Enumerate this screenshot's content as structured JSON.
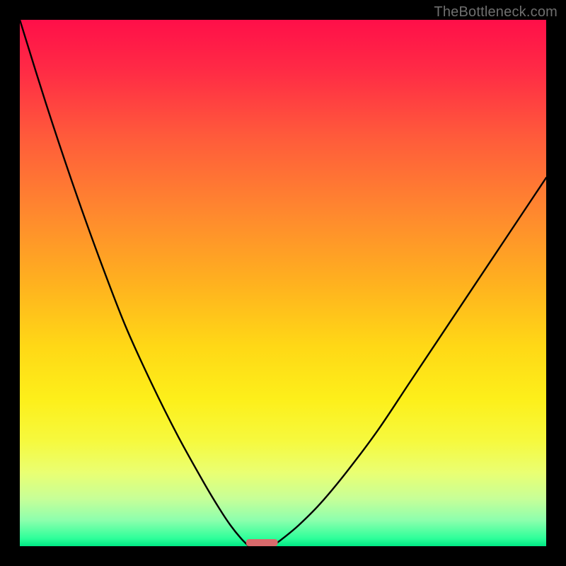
{
  "watermark": "TheBottleneck.com",
  "chart_data": {
    "type": "line",
    "title": "",
    "xlabel": "",
    "ylabel": "",
    "xlim": [
      0,
      100
    ],
    "ylim": [
      0,
      100
    ],
    "grid": false,
    "legend": false,
    "annotations": [],
    "series": [
      {
        "name": "left-branch",
        "x": [
          0,
          5,
          10,
          15,
          20,
          25,
          30,
          35,
          38,
          40,
          42,
          43.5
        ],
        "y": [
          100,
          84,
          69,
          55,
          42,
          31,
          21,
          12,
          7,
          4,
          1.5,
          0
        ]
      },
      {
        "name": "right-branch",
        "x": [
          48,
          50,
          53,
          57,
          62,
          68,
          74,
          80,
          86,
          92,
          98,
          100
        ],
        "y": [
          0,
          1.5,
          4,
          8,
          14,
          22,
          31,
          40,
          49,
          58,
          67,
          70
        ]
      }
    ],
    "minimum_marker": {
      "x_start": 43,
      "x_end": 49,
      "y": 0
    },
    "background_gradient": {
      "stops": [
        {
          "offset": 0.0,
          "color": "#ff0f49"
        },
        {
          "offset": 0.1,
          "color": "#ff2c45"
        },
        {
          "offset": 0.22,
          "color": "#ff5a3b"
        },
        {
          "offset": 0.35,
          "color": "#ff8330"
        },
        {
          "offset": 0.5,
          "color": "#ffb11f"
        },
        {
          "offset": 0.62,
          "color": "#ffd816"
        },
        {
          "offset": 0.72,
          "color": "#fdef1a"
        },
        {
          "offset": 0.8,
          "color": "#f6f93e"
        },
        {
          "offset": 0.86,
          "color": "#eaff72"
        },
        {
          "offset": 0.91,
          "color": "#c7ff98"
        },
        {
          "offset": 0.95,
          "color": "#8effad"
        },
        {
          "offset": 0.985,
          "color": "#2eff9a"
        },
        {
          "offset": 1.0,
          "color": "#00e884"
        }
      ]
    }
  }
}
